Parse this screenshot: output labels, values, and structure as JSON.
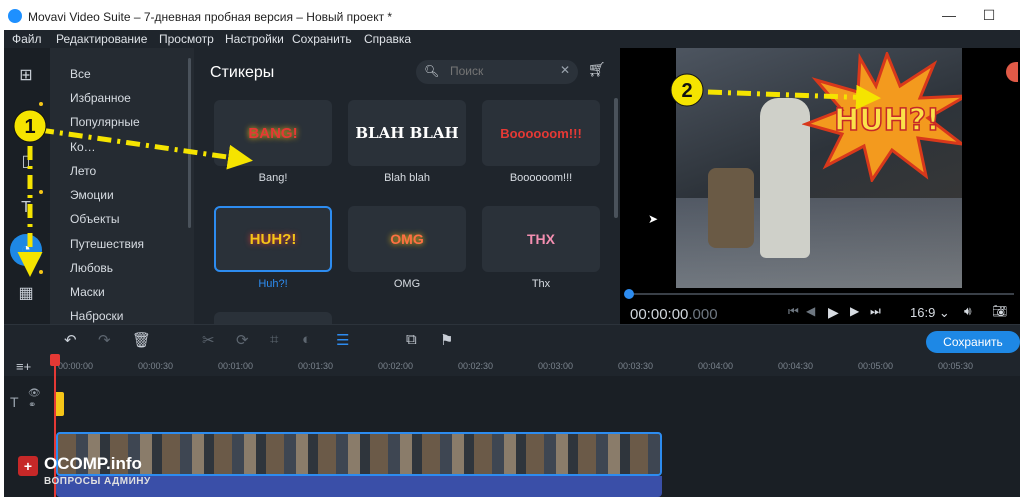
{
  "window": {
    "title": "Movavi Video Suite – 7-дневная пробная версия – Новый проект *",
    "minimize": "—",
    "maximize": "☐"
  },
  "menu": [
    "Файл",
    "Редактирование",
    "Просмотр",
    "Настройки",
    "Сохранить",
    "Справка"
  ],
  "side_tools": [
    "import-icon",
    "filters-icon",
    "transitions-icon",
    "titles-icon",
    "stickers-icon",
    "more-tools-icon"
  ],
  "categories": [
    "Все",
    "Избранное",
    "Популярные",
    "Ко…",
    "Лето",
    "Эмоции",
    "Объекты",
    "Путешествия",
    "Любовь",
    "Маски",
    "Наброски"
  ],
  "stickers_panel": {
    "heading": "Стикеры",
    "search_placeholder": "Поиск",
    "items": [
      {
        "label": "Bang!",
        "art": "BANG!",
        "color": "#e53935"
      },
      {
        "label": "Blah blah",
        "art": "BLAH BLAH",
        "color": "#ffffff"
      },
      {
        "label": "Boooooom!!!",
        "art": "Boooooom!!!",
        "color": "#e53935"
      },
      {
        "label": "Huh?!",
        "art": "HUH?!",
        "color": "#f5c518"
      },
      {
        "label": "OMG",
        "art": "OMG",
        "color": "#ff7043"
      },
      {
        "label": "Thx",
        "art": "THX",
        "color": "#f48fb1"
      }
    ],
    "selected_index": 3
  },
  "preview": {
    "sticker_text": "HUH?!",
    "timecode_main": "00:00:00",
    "timecode_ms": ".000",
    "aspect": "16:9 ⌄",
    "progress": 0.0
  },
  "toolbar": {
    "save_label": "Сохранить"
  },
  "ruler_ticks": [
    "00:00:00",
    "00:00:30",
    "00:01:00",
    "00:01:30",
    "00:02:00",
    "00:02:30",
    "00:03:00",
    "00:03:30",
    "00:04:00",
    "00:04:30",
    "00:05:00",
    "00:05:30"
  ],
  "annotations": {
    "marker1": "1",
    "marker2": "2",
    "color": "#f5e400"
  },
  "watermark": {
    "brand": "OCOMP.info",
    "sub": "ВОПРОСЫ АДМИНУ"
  },
  "colors": {
    "accent": "#1e88e5",
    "selection": "#2d8cf0",
    "panel": "#1f252c",
    "playhead": "#e53935"
  }
}
